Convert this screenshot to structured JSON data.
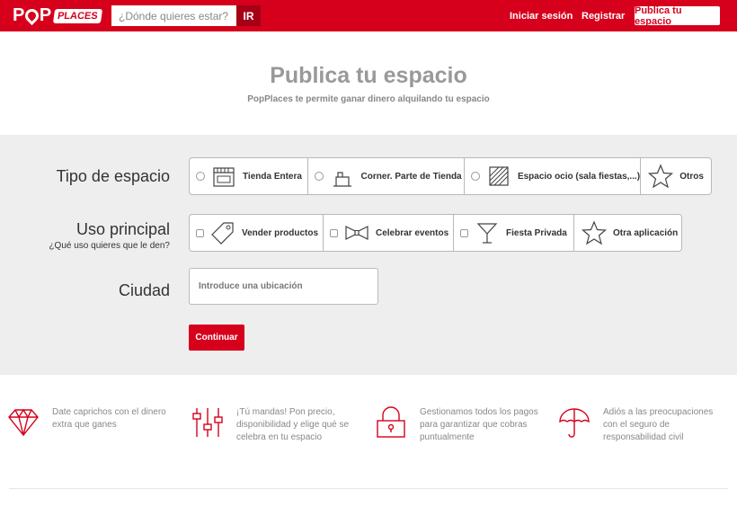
{
  "header": {
    "logo_pop": "POP",
    "logo_places": "PLACES",
    "search_placeholder": "¿Dónde quieres estar?",
    "search_button": "IR",
    "login": "Iniciar sesión",
    "register": "Registrar",
    "publish": "Publica tu espacio"
  },
  "hero": {
    "title": "Publica tu espacio",
    "subtitle": "PopPlaces te permite ganar dinero alquilando tu espacio"
  },
  "form": {
    "tipo_label": "Tipo de espacio",
    "tipo_options": [
      {
        "label": "Tienda Entera",
        "icon": "store-icon"
      },
      {
        "label": "Corner. Parte de Tienda",
        "icon": "corner-icon"
      },
      {
        "label": "Espacio ocio (sala fiestas,...)",
        "icon": "leisure-space-icon"
      },
      {
        "label": "Otros",
        "icon": "star-icon"
      }
    ],
    "uso_label": "Uso principal",
    "uso_sublabel": "¿Qué uso quieres que le den?",
    "uso_options": [
      {
        "label": "Vender productos",
        "icon": "price-tag-icon"
      },
      {
        "label": "Celebrar eventos",
        "icon": "bow-tie-icon"
      },
      {
        "label": "Fiesta Privada",
        "icon": "cocktail-icon"
      },
      {
        "label": "Otra aplicación",
        "icon": "star-icon"
      }
    ],
    "ciudad_label": "Ciudad",
    "ciudad_placeholder": "Introduce una ubicación",
    "continue": "Continuar"
  },
  "features": [
    {
      "icon": "diamond-icon",
      "text": "Date caprichos con el dinero extra que ganes"
    },
    {
      "icon": "sliders-icon",
      "text": "¡Tú mandas! Pon precio, disponibilidad y elige qué se celebra en tu espacio"
    },
    {
      "icon": "padlock-icon",
      "text": "Gestionamos todos los pagos para garantizar que cobras puntualmente"
    },
    {
      "icon": "umbrella-icon",
      "text": "Adiós a las preocupaciones con el seguro de responsabilidad civil"
    }
  ],
  "colors": {
    "brand": "#d6001c",
    "form_bg": "#eeeeee"
  }
}
